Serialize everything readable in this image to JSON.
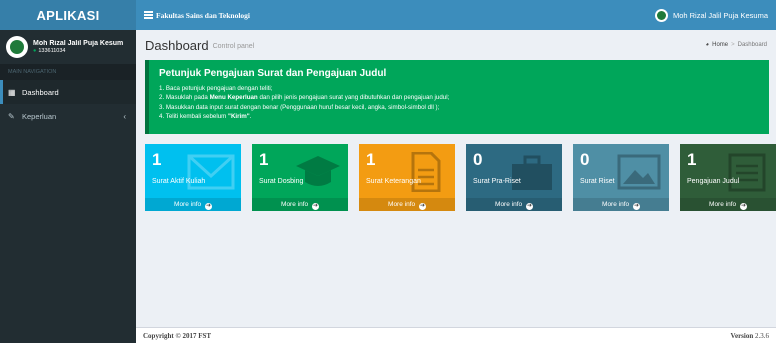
{
  "header": {
    "brand": "APLIKASI",
    "nav_title": "Fakultas Sains dan Teknologi",
    "user_name": "Moh Rizal Jalil Puja Kesuma"
  },
  "sidebar": {
    "user_name": "Moh Rizal Jalil Puja Kesum",
    "user_id": "133611034",
    "section_header": "MAIN NAVIGATION",
    "items": [
      {
        "label": "Dashboard"
      },
      {
        "label": "Keperluan"
      }
    ]
  },
  "content": {
    "title": "Dashboard",
    "subtitle": "Control panel",
    "breadcrumb": {
      "home": "Home",
      "current": "Dashboard"
    }
  },
  "callout": {
    "title": "Petunjuk Pengajuan Surat dan Pengajuan Judul",
    "items": [
      {
        "pre": "1. Baca petunjuk pengajuan dengan teliti;",
        "bold": "",
        "post": ""
      },
      {
        "pre": "2. Masuklah pada ",
        "bold": "Menu Keperluan",
        "post": " dan pilih jenis pengajuan surat yang dibutuhkan dan pengajuan judul;"
      },
      {
        "pre": "3. Masukkan data input surat dengan benar (Penggunaan huruf besar kecil, angka, simbol-simbol dll );",
        "bold": "",
        "post": ""
      },
      {
        "pre": "4. Teliti kembali sebelum ",
        "bold": "\"Kirim\"",
        "post": "."
      }
    ]
  },
  "boxes": [
    {
      "count": "1",
      "label": "Surat Aktif Kuliah",
      "more": "More info",
      "color": "#00c0ef",
      "icon": "envelope-icon"
    },
    {
      "count": "1",
      "label": "Surat Dosbing",
      "more": "More info",
      "color": "#00a65a",
      "icon": "graduation-cap-icon"
    },
    {
      "count": "1",
      "label": "Surat Keterangan",
      "more": "More info",
      "color": "#f39c12",
      "icon": "document-icon"
    },
    {
      "count": "0",
      "label": "Surat Pra-Riset",
      "more": "More info",
      "color": "#2d6a82",
      "icon": "briefcase-icon"
    },
    {
      "count": "0",
      "label": "Surat Riset",
      "more": "More info",
      "color": "#4f8fa5",
      "icon": "picture-icon"
    },
    {
      "count": "1",
      "label": "Pengajuan Judul",
      "more": "More info",
      "color": "#2f5d39",
      "icon": "notebook-icon"
    }
  ],
  "footer": {
    "copyright": "Copyright © 2017 FST",
    "version_label": "Version",
    "version": "2.3.6"
  }
}
